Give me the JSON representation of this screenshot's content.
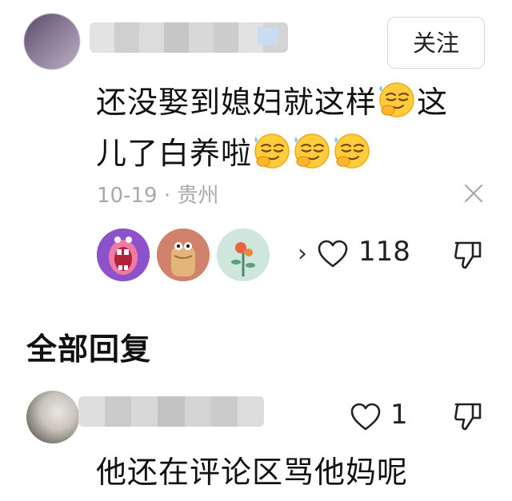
{
  "comment": {
    "follow_label": "关注",
    "text_line1": "还没娶到媳妇就这样",
    "text_line1_end": "这",
    "text_line2": "儿了白养啦",
    "emoji_icon": "smug-emoji-icon",
    "date": "10-19",
    "dot": "·",
    "location": "贵州",
    "likes": "118",
    "chevron": "›"
  },
  "replies_section": {
    "title": "全部回复"
  },
  "reply": {
    "likes": "1",
    "text": "他还在评论区骂他妈呢"
  },
  "colors": {
    "text": "#111111",
    "meta": "#a9a9a9",
    "border": "#d7d7d7"
  }
}
